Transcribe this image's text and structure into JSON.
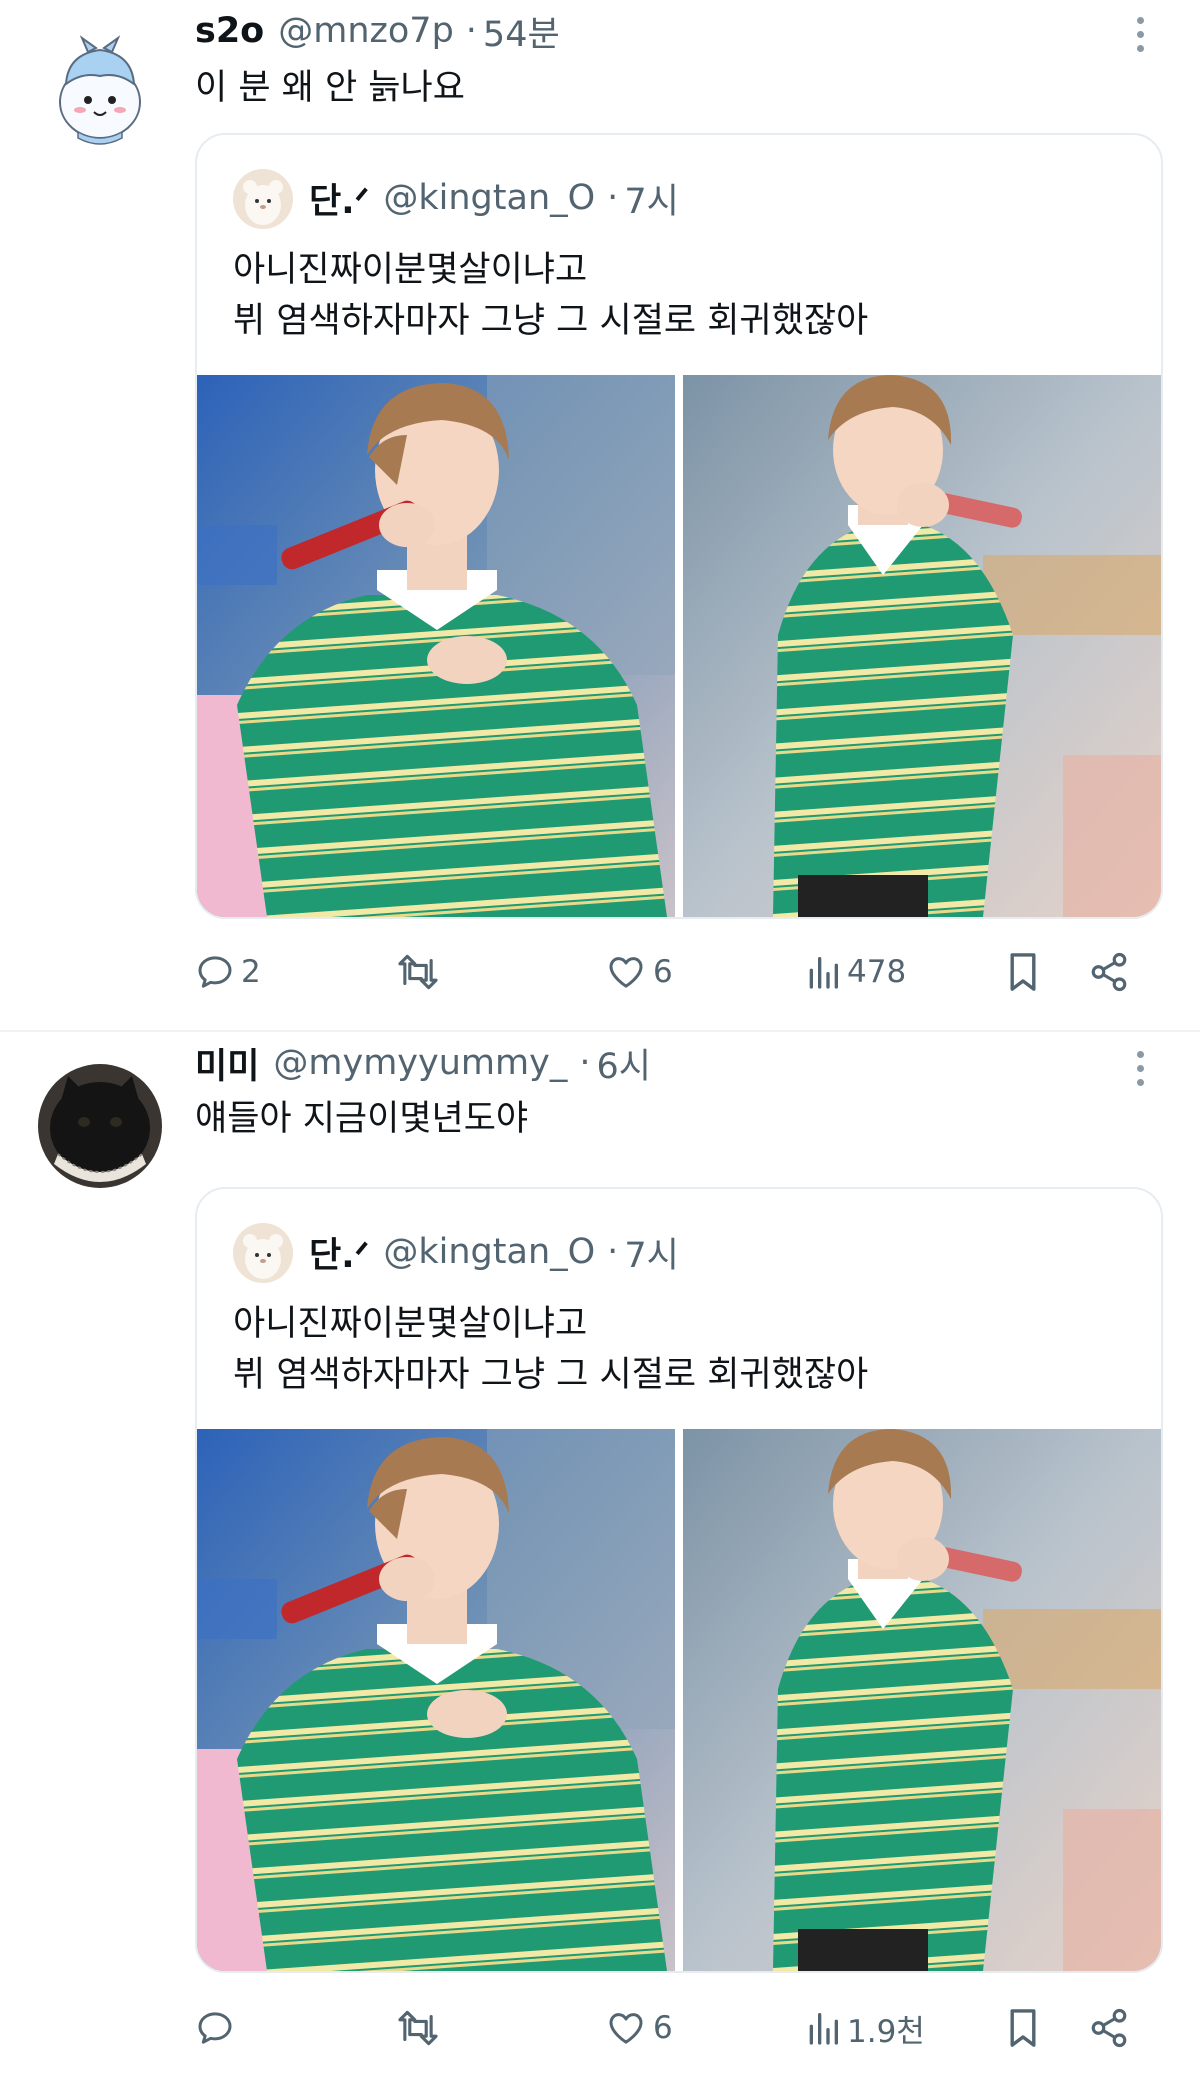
{
  "tweets": [
    {
      "display_name": "s2o",
      "handle": "@mnzo7p",
      "separator": "·",
      "time": "54분",
      "text": "이 분 왜 안 늙나요",
      "quote": {
        "display_name": "단.ᐟ",
        "handle": "@kingtan_O",
        "separator": "·",
        "time": "7시",
        "lines": [
          "아니진짜이분몇살이냐고",
          "뷔 염색하자마자 그냥 그 시절로 회귀했잖아"
        ]
      },
      "actions": {
        "replies": "2",
        "retweets": "",
        "likes": "6",
        "views": "478"
      }
    },
    {
      "display_name": "미미",
      "handle": "@mymyyummy_",
      "separator": "·",
      "time": "6시",
      "text": "얘들아 지금이몇년도야",
      "quote": {
        "display_name": "단.ᐟ",
        "handle": "@kingtan_O",
        "separator": "·",
        "time": "7시",
        "lines": [
          "아니진짜이분몇살이냐고",
          "뷔 염색하자마자 그냥 그 시절로 회귀했잖아"
        ]
      },
      "actions": {
        "replies": "",
        "retweets": "",
        "likes": "6",
        "views": "1.9천"
      }
    }
  ],
  "icons": [
    "reply-icon",
    "retweet-icon",
    "like-icon",
    "views-icon",
    "bookmark-icon",
    "share-icon",
    "more-icon"
  ],
  "colors": {
    "text": "#0f1419",
    "secondary": "#536471",
    "border": "#e7ecf0",
    "sweater_green": "#1f9a72",
    "stripe_yellow": "#f2e9a6"
  }
}
